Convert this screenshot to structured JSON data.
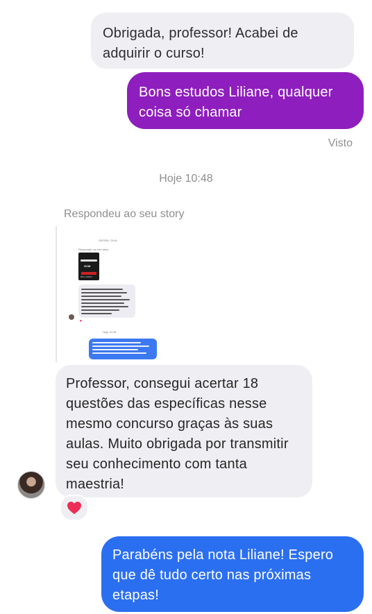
{
  "thread": {
    "msg1": "Obrigada, professor! Acabei de adquirir o curso!",
    "msg2": "Bons estudos Liliane, qualquer coisa só chamar",
    "seen": "Visto",
    "timestamp": "Hoje 10:48",
    "reply_label": "Respondeu ao seu story",
    "msg3": "Professor, consegui acertar 18 questões das específicas nesse mesmo concurso graças às suas aulas. Muito obrigada por transmitir seu conhecimento com tanta maestria!",
    "msg4": "Parabéns pela nota Liliane! Espero que dê tudo certo nas próximas etapas!"
  },
  "story_preview": {
    "top_time": "ONTEM, 23:46",
    "label": "Respondeu ao seu story",
    "thumb_text_1": "GCM",
    "thumb_text_2": "RIO LARGO",
    "in_message": "Boa noite, quero relatar que assistindo seus vídeos no YouTube consegui acertar 16 questões de 20 de conhecimento específicos, da Guarda Municipal de Rio Largo. Fica registrado o meu agradecimento.",
    "time": "Hoje 10:18",
    "out_message": "Bom dia Hugo, fico muito satisfeito em saber que os vídeos ajudaram, parabéns pela nota, espero que dê tudo certo! Abraço"
  },
  "reaction": {
    "emoji": "heart",
    "color": "#ed2e57"
  },
  "colors": {
    "incoming": "#efeff3",
    "outgoing_purple": "#8e1ebd",
    "outgoing_blue": "#2b6ff1",
    "meta": "#8e8e8e"
  }
}
